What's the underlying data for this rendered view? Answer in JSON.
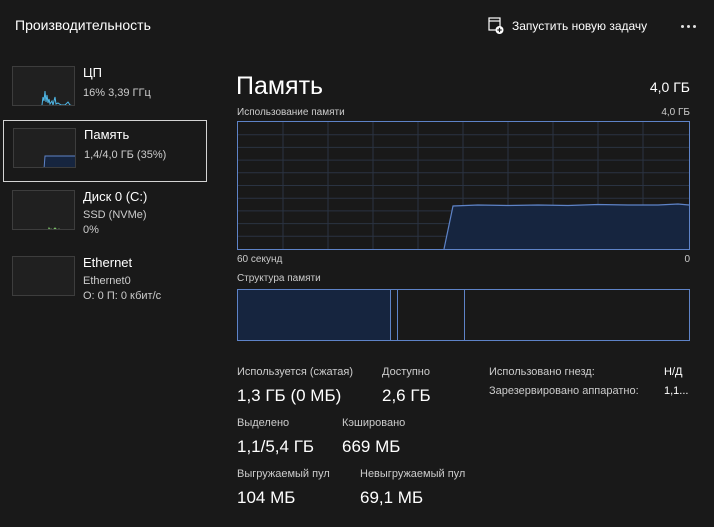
{
  "header": {
    "title": "Производительность",
    "run_task_label": "Запустить новую задачу",
    "more_icon": "more-horizontal-icon"
  },
  "sidebar": {
    "items": [
      {
        "name": "ЦП",
        "line1": "16% 3,39 ГГц",
        "line2": "",
        "selected": false,
        "graph_color": "#4fb8e8"
      },
      {
        "name": "Память",
        "line1": "1,4/4,0 ГБ (35%)",
        "line2": "",
        "selected": true,
        "graph_color": "#5e83c7"
      },
      {
        "name": "Диск 0 (C:)",
        "line1": "SSD (NVMe)",
        "line2": "0%",
        "selected": false,
        "graph_color": "#7ec46a"
      },
      {
        "name": "Ethernet",
        "line1": "Ethernet0",
        "line2": "О: 0 П: 0 кбит/с",
        "selected": false,
        "graph_color": "#c8a0d8"
      }
    ]
  },
  "main": {
    "title": "Память",
    "total": "4,0 ГБ",
    "usage_chart": {
      "label": "Использование памяти",
      "max_label": "4,0 ГБ",
      "axis_left": "60 секунд",
      "axis_right": "0",
      "accent": "#5e83c7"
    },
    "composition": {
      "label": "Структура памяти"
    },
    "stats": {
      "in_use_label": "Используется (сжатая)",
      "in_use_value": "1,3 ГБ (0 МБ)",
      "available_label": "Доступно",
      "available_value": "2,6 ГБ",
      "committed_label": "Выделено",
      "committed_value": "1,1/5,4 ГБ",
      "cached_label": "Кэшировано",
      "cached_value": "669 МБ",
      "paged_label": "Выгружаемый пул",
      "paged_value": "104 МБ",
      "nonpaged_label": "Невыгружаемый пул",
      "nonpaged_value": "69,1 МБ"
    },
    "details": {
      "slots_key": "Использовано гнезд:",
      "slots_val": "Н/Д",
      "reserved_key": "Зарезервировано аппаратно:",
      "reserved_val": "1,1..."
    }
  }
}
